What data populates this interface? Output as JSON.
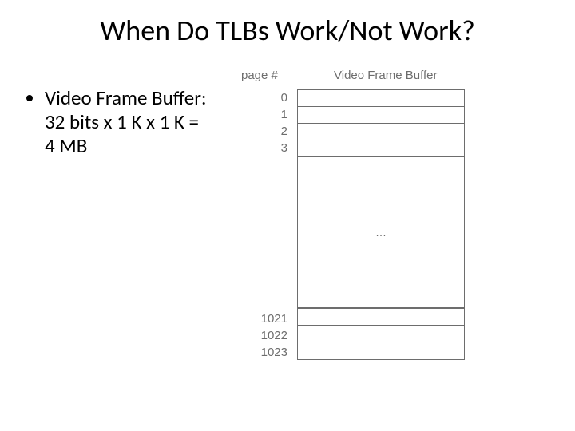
{
  "title": "When Do TLBs Work/Not Work?",
  "bullet": "Video Frame Buffer: 32 bits x 1 K x 1 K = 4 MB",
  "diagram": {
    "header_page": "page #",
    "header_vfb": "Video Frame Buffer",
    "top_pages": [
      "0",
      "1",
      "2",
      "3"
    ],
    "ellipsis": "…",
    "bottom_pages": [
      "1021",
      "1022",
      "1023"
    ]
  }
}
